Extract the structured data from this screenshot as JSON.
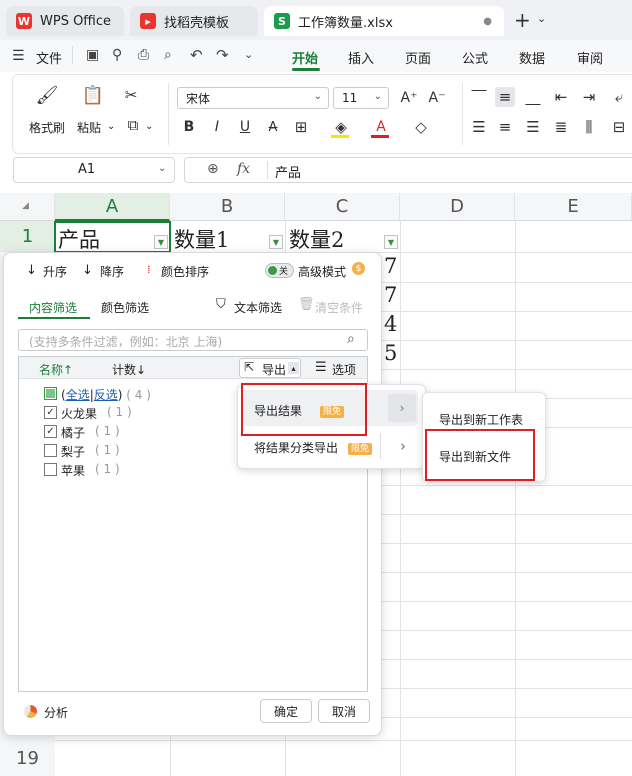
{
  "tabs": [
    {
      "label": "WPS Office"
    },
    {
      "label": "找稻壳模板"
    },
    {
      "label": "工作簿数量.xlsx"
    }
  ],
  "tab_plus": "+",
  "menu": {
    "file": "文件",
    "items": [
      "开始",
      "插入",
      "页面",
      "公式",
      "数据",
      "审阅"
    ],
    "active": "开始"
  },
  "ribbon": {
    "format_painter": "格式刷",
    "paste": "粘贴",
    "font_name": "宋体",
    "font_size": "11"
  },
  "formula_bar": {
    "cell_ref": "A1",
    "fx": "fx",
    "content": "产品"
  },
  "grid": {
    "columns": [
      "A",
      "B",
      "C",
      "D",
      "E"
    ],
    "row_labels": [
      "1",
      "19"
    ],
    "a1": "产品",
    "b1": "数量1",
    "c1": "数量2",
    "visible_c_values": [
      "7",
      "7",
      "4",
      "5"
    ]
  },
  "filter_panel": {
    "sort_asc": "升序",
    "sort_desc": "降序",
    "color_sort": "颜色排序",
    "toggle_text": "关",
    "advanced_mode": "高级模式",
    "tab_content": "内容筛选",
    "tab_color": "颜色筛选",
    "text_filter": "文本筛选",
    "clear_condition": "清空条件",
    "search_placeholder": "(支持多条件过滤，例如：北京  上海)",
    "col_name": "名称↑",
    "col_count": "计数↓",
    "export": "导出",
    "options": "选项",
    "select_all_prefix": "(",
    "select_all": "全选",
    "select_sep": "|",
    "invert": "反选",
    "select_all_suffix": ")",
    "select_all_count": "( 4 )",
    "items": [
      {
        "name": "火龙果",
        "count": "( 1 )",
        "checked": true
      },
      {
        "name": "橘子",
        "count": "( 1 )",
        "checked": true
      },
      {
        "name": "梨子",
        "count": "( 1 )",
        "checked": false
      },
      {
        "name": "苹果",
        "count": "( 1 )",
        "checked": false
      }
    ],
    "analysis": "分析",
    "ok": "确定",
    "cancel": "取消"
  },
  "export_menu": {
    "export_result": "导出结果",
    "export_by_category": "将结果分类导出",
    "badge": "限免",
    "to_new_sheet": "导出到新工作表",
    "to_new_file": "导出到新文件"
  },
  "colors": {
    "accent_green": "#1a7f37",
    "highlight_red": "#e02020",
    "badge_orange": "#f6b04a"
  }
}
